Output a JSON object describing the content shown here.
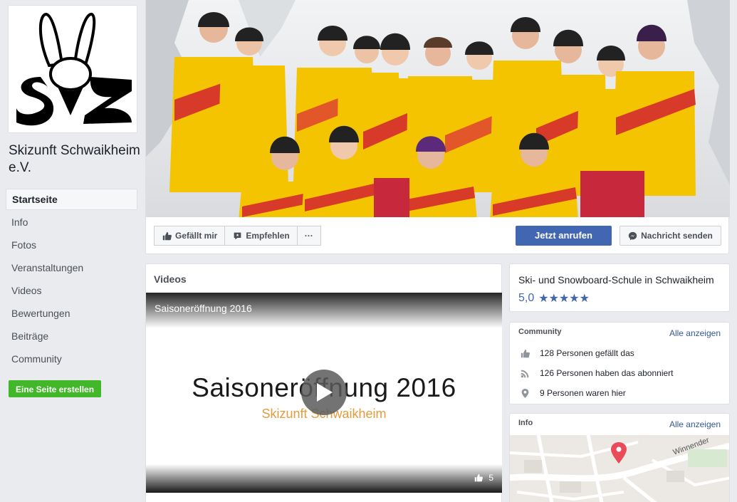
{
  "page": {
    "name": "Skizunft Schwaikheim e.V.",
    "logo_letters": "SZ"
  },
  "nav": {
    "items": [
      {
        "label": "Startseite",
        "active": true
      },
      {
        "label": "Info"
      },
      {
        "label": "Fotos"
      },
      {
        "label": "Veranstaltungen"
      },
      {
        "label": "Videos"
      },
      {
        "label": "Bewertungen"
      },
      {
        "label": "Beiträge"
      },
      {
        "label": "Community"
      }
    ],
    "create_page": "Eine Seite erstellen"
  },
  "actions": {
    "like": "Gefällt mir",
    "recommend": "Empfehlen",
    "more": "···",
    "call": "Jetzt anrufen",
    "message": "Nachricht senden"
  },
  "videos": {
    "heading": "Videos",
    "video_title": "Saisoneröffnung 2016",
    "slate_title": "Saisoneröffnung 2016",
    "slate_subtitle": "Skizunft Schwaikheim",
    "likes": "5"
  },
  "about": {
    "description": "Ski- und Snowboard-Schule in Schwaikheim",
    "rating": "5,0",
    "stars": "★★★★★"
  },
  "community": {
    "heading": "Community",
    "see_all": "Alle anzeigen",
    "likes": "128 Personen gefällt das",
    "followers": "126 Personen haben das abonniert",
    "checkins": "9 Personen waren hier"
  },
  "info": {
    "heading": "Info",
    "see_all": "Alle anzeigen",
    "street": "Winnender"
  },
  "colors": {
    "brand_blue": "#4267b2",
    "create_green": "#42b72a",
    "jacket_yellow": "#f5c400",
    "jacket_red": "#d83a2a",
    "map_pin": "#e94b58"
  }
}
